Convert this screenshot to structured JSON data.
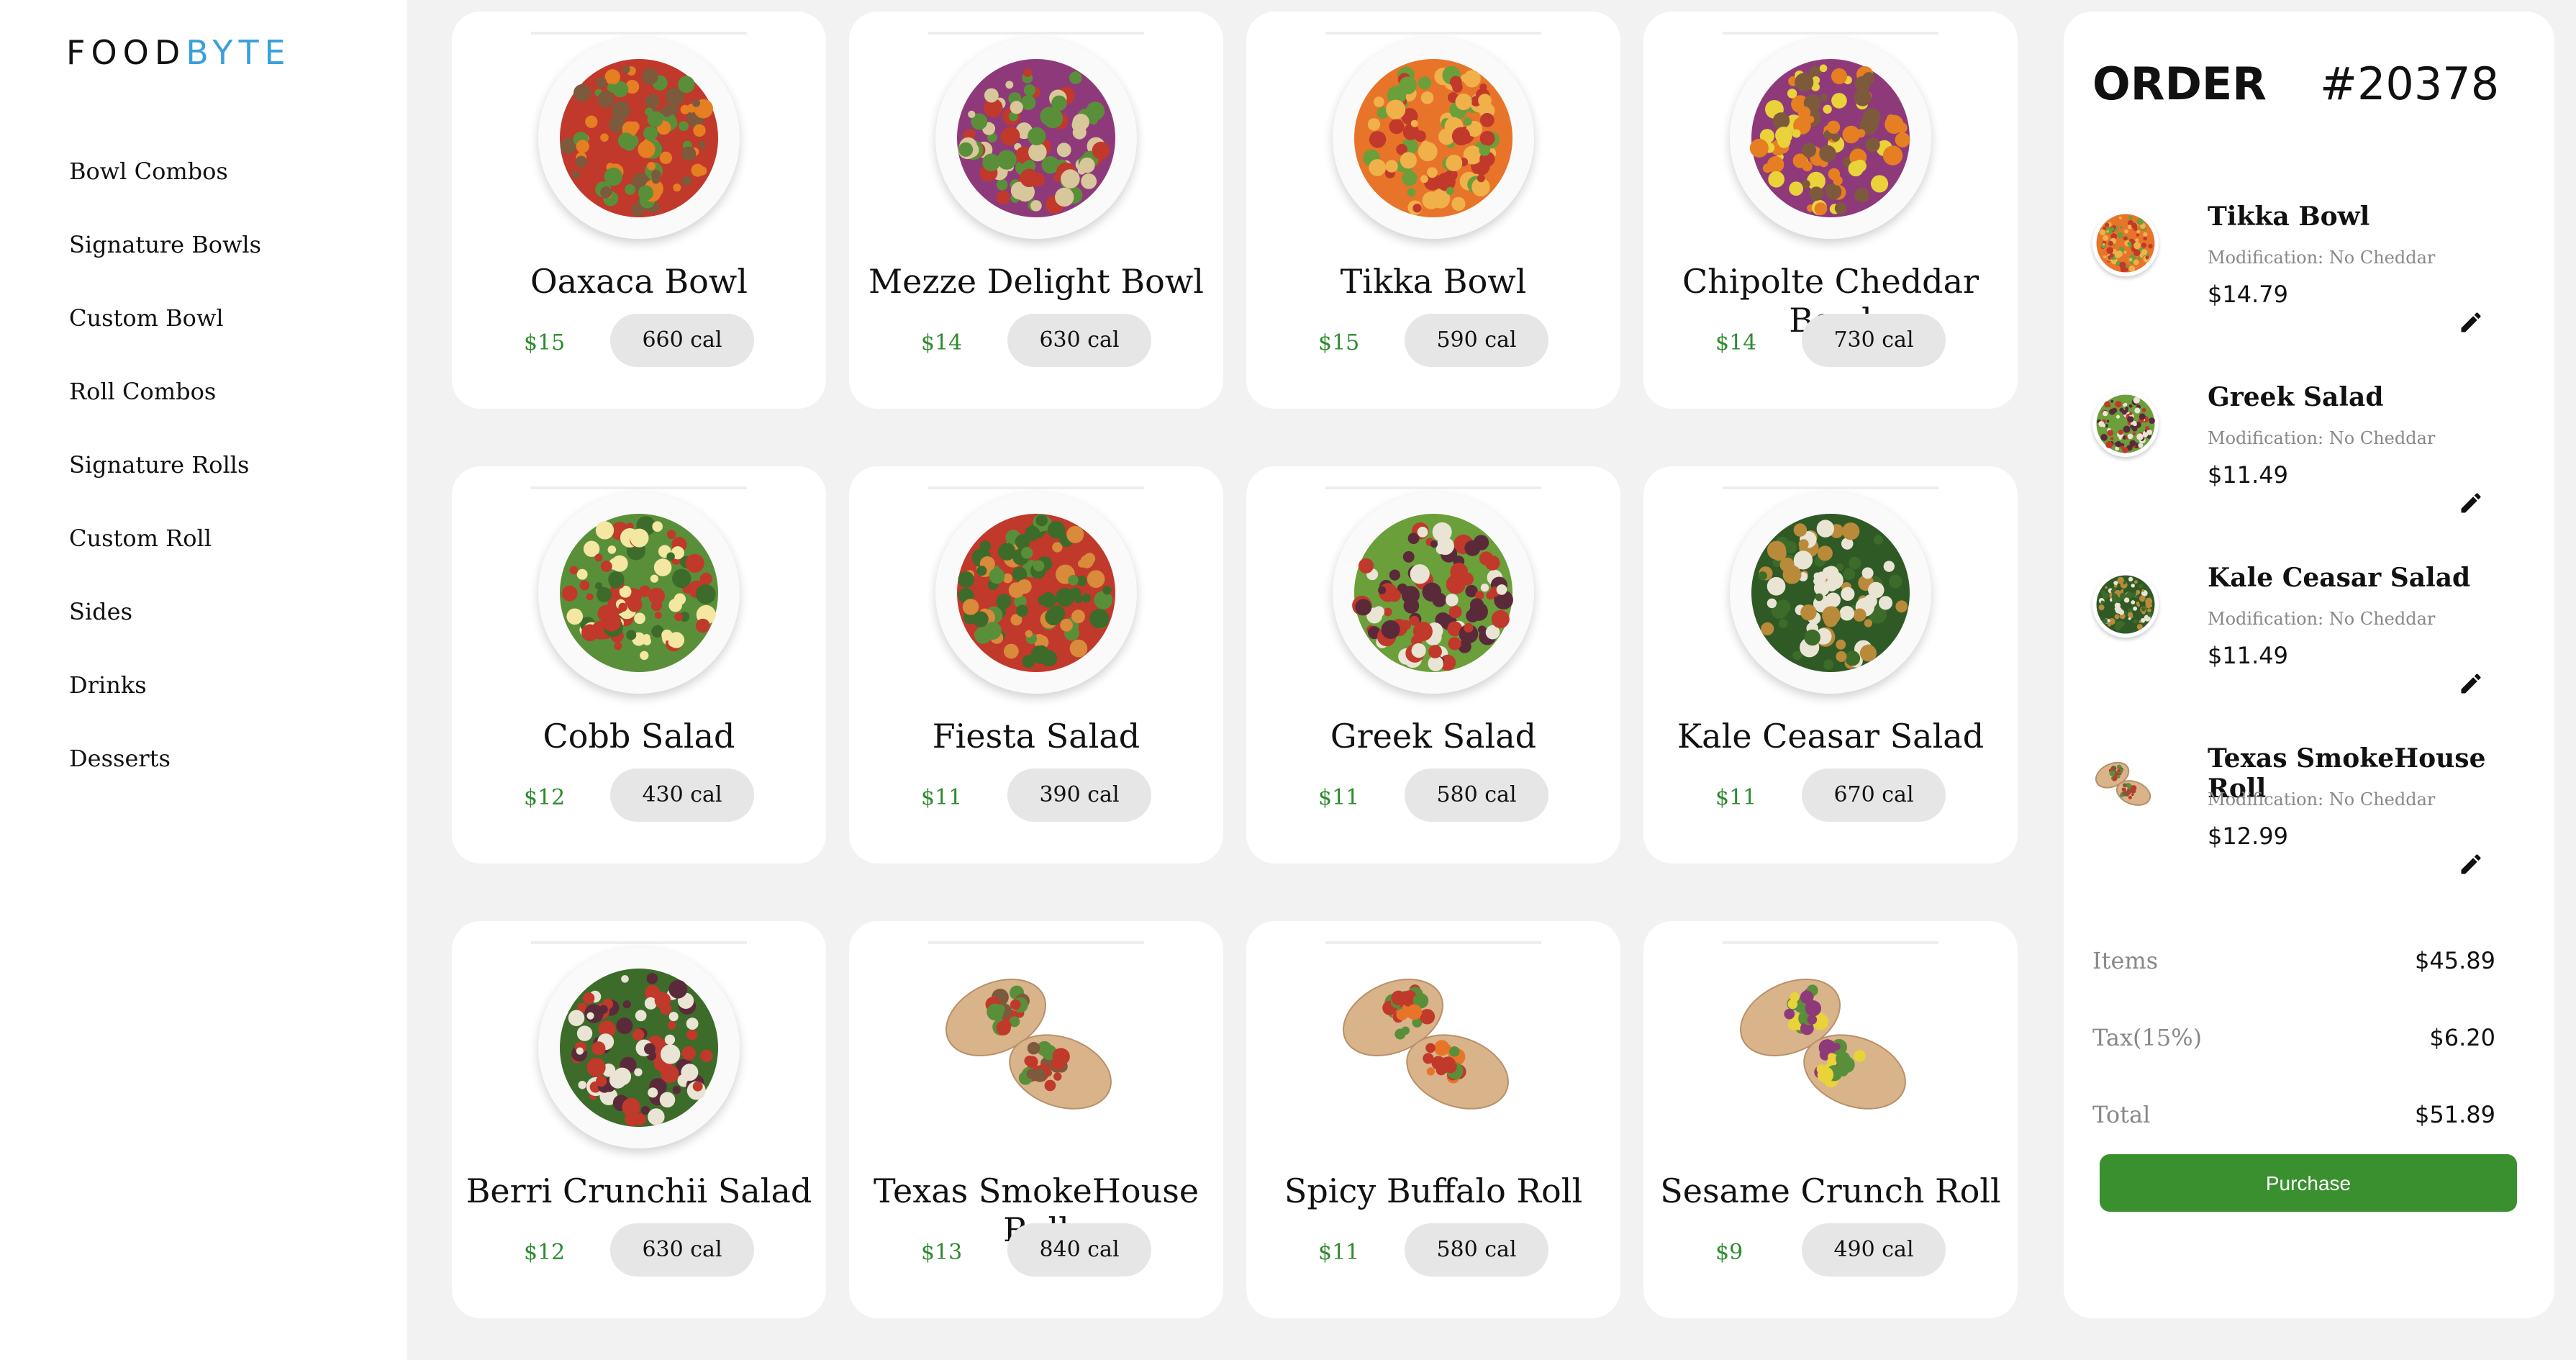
{
  "brand": {
    "part1": "FOOD",
    "part2": "BYTE",
    "accent": "#3aa0dc"
  },
  "sidebar": {
    "items": [
      {
        "label": "Bowl Combos"
      },
      {
        "label": "Signature Bowls"
      },
      {
        "label": "Custom Bowl"
      },
      {
        "label": "Roll Combos"
      },
      {
        "label": "Signature Rolls"
      },
      {
        "label": "Custom Roll"
      },
      {
        "label": "Sides"
      },
      {
        "label": "Drinks"
      },
      {
        "label": "Desserts"
      }
    ]
  },
  "menu": {
    "items": [
      {
        "name": "Oaxaca Bowl",
        "price": "$15",
        "cal": "660 cal",
        "kind": "bowl",
        "colors": [
          "#c0392b",
          "#e67e22",
          "#7d5a3c",
          "#5a8f3a"
        ]
      },
      {
        "name": "Mezze Delight Bowl",
        "price": "$14",
        "cal": "630 cal",
        "kind": "bowl",
        "colors": [
          "#8e3a7a",
          "#5a8f3a",
          "#c0392b",
          "#d7c79a"
        ]
      },
      {
        "name": "Tikka Bowl",
        "price": "$15",
        "cal": "590 cal",
        "kind": "bowl",
        "colors": [
          "#e8742a",
          "#c0392b",
          "#6a9f3a",
          "#f0b14a"
        ]
      },
      {
        "name": "Chipolte Cheddar Bowl",
        "price": "$14",
        "cal": "730 cal",
        "kind": "bowl",
        "colors": [
          "#8e3a7a",
          "#e67e22",
          "#7d5a3c",
          "#e9d23a"
        ]
      },
      {
        "name": "Cobb Salad",
        "price": "$12",
        "cal": "430 cal",
        "kind": "bowl",
        "colors": [
          "#5a8f3a",
          "#f4e7a1",
          "#c0392b",
          "#3d6b2a"
        ]
      },
      {
        "name": "Fiesta Salad",
        "price": "$11",
        "cal": "390 cal",
        "kind": "bowl",
        "colors": [
          "#c0392b",
          "#5a8f3a",
          "#d98a3a",
          "#3d6b2a"
        ]
      },
      {
        "name": "Greek Salad",
        "price": "$11",
        "cal": "580 cal",
        "kind": "bowl",
        "colors": [
          "#6a9f3a",
          "#5a2a3a",
          "#e9e4d4",
          "#c0392b"
        ]
      },
      {
        "name": "Kale Ceasar Salad",
        "price": "$11",
        "cal": "670 cal",
        "kind": "bowl",
        "colors": [
          "#2f5a25",
          "#3d6b2a",
          "#e9e4d4",
          "#b88a3a"
        ]
      },
      {
        "name": "Berri Crunchii Salad",
        "price": "$12",
        "cal": "630 cal",
        "kind": "bowl",
        "colors": [
          "#3d6b2a",
          "#c0392b",
          "#5a2a3a",
          "#e9e4d4"
        ]
      },
      {
        "name": "Texas SmokeHouse Roll",
        "price": "$13",
        "cal": "840 cal",
        "kind": "roll",
        "colors": [
          "#d9b48a",
          "#c0392b",
          "#5a8f3a",
          "#7d5a3c"
        ]
      },
      {
        "name": "Spicy Buffalo Roll",
        "price": "$11",
        "cal": "580 cal",
        "kind": "roll",
        "colors": [
          "#d9b48a",
          "#e8742a",
          "#5a8f3a",
          "#c0392b"
        ]
      },
      {
        "name": "Sesame Crunch Roll",
        "price": "$9",
        "cal": "490 cal",
        "kind": "roll",
        "colors": [
          "#d9b48a",
          "#8e3a7a",
          "#5a8f3a",
          "#e9d23a"
        ]
      }
    ]
  },
  "order": {
    "title": "ORDER",
    "number": "#20378",
    "items": [
      {
        "name": "Tikka Bowl",
        "mod": "Modification: No Cheddar",
        "price": "$14.79"
      },
      {
        "name": "Greek Salad",
        "mod": "Modification: No Cheddar",
        "price": "$11.49"
      },
      {
        "name": "Kale Ceasar Salad",
        "mod": "Modification: No Cheddar",
        "price": "$11.49"
      },
      {
        "name": "Texas SmokeHouse Roll",
        "mod": "Modification: No Cheddar",
        "price": "$12.99"
      }
    ],
    "summary": {
      "items_label": "Items",
      "items_value": "$45.89",
      "tax_label": "Tax(15%)",
      "tax_value": "$6.20",
      "total_label": "Total",
      "total_value": "$51.89"
    },
    "purchase_label": "Purchase",
    "purchase_color": "#3a8f2e"
  },
  "icons": {
    "edit": "pencil-icon"
  }
}
